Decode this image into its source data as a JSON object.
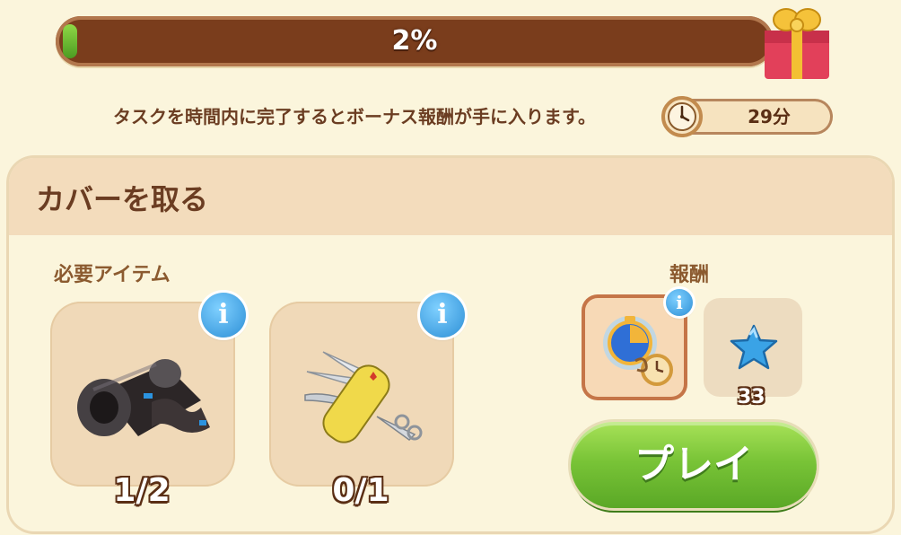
{
  "progress": {
    "value_percent": 2,
    "label": "2%"
  },
  "hint": {
    "text": "タスクを時間内に完了するとボーナス報酬が手に入ります。",
    "timer_label": "29分"
  },
  "panel": {
    "title": "カバーを取る",
    "required_label": "必要アイテム",
    "reward_label": "報酬",
    "items": [
      {
        "icon": "black-tape-roll-icon",
        "count": "1/2"
      },
      {
        "icon": "pocket-knife-icon",
        "count": "0/1"
      }
    ],
    "rewards": [
      {
        "icon": "timer-booster-icon",
        "selected": true
      },
      {
        "icon": "blue-star-icon",
        "count": "33"
      }
    ],
    "play_label": "プレイ"
  },
  "info_glyph": "i",
  "colors": {
    "accent_green": "#79c437",
    "brown_text": "#6b3d22",
    "panel_bg": "#fbf5dc"
  }
}
